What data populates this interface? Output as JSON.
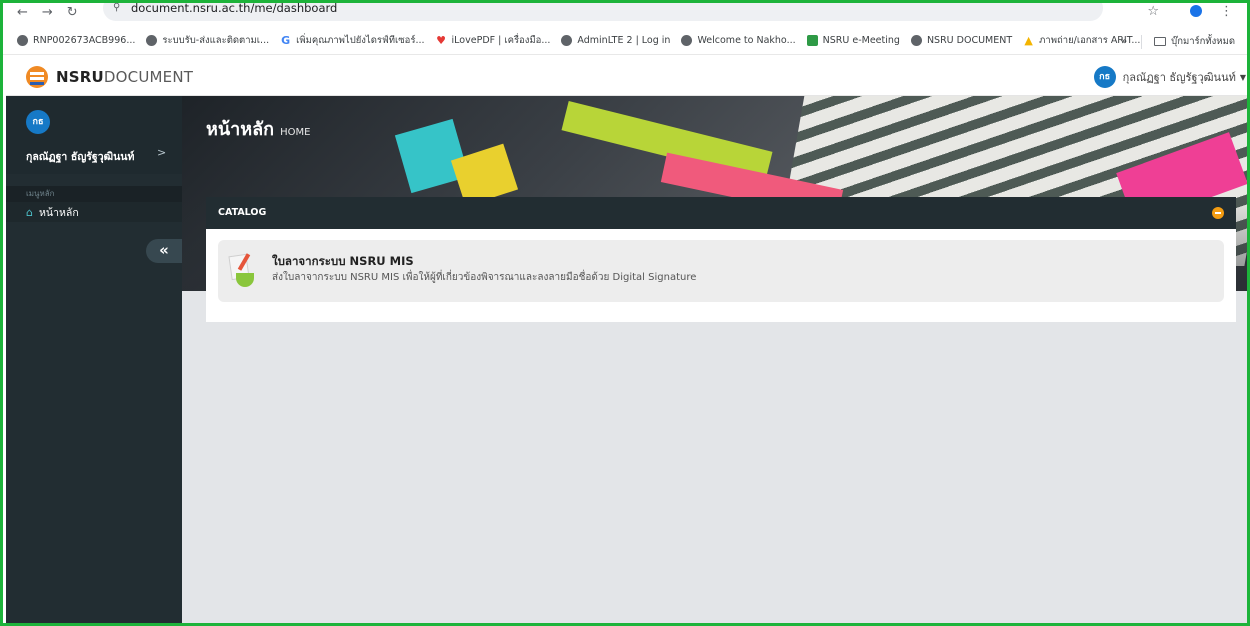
{
  "browser": {
    "url": "document.nsru.ac.th/me/dashboard",
    "bookmarks": [
      {
        "label": "RNP002673ACB996...",
        "icon": "globe-icon"
      },
      {
        "label": "ระบบรับ-ส่งและติดตามเ...",
        "icon": "globe-icon"
      },
      {
        "label": "เพิ่มคุณภาพไปยังไดรฟ์ทีเซอร์...",
        "icon": "google-icon"
      },
      {
        "label": "iLovePDF | เครื่องมือ...",
        "icon": "heart-icon"
      },
      {
        "label": "AdminLTE 2 | Log in",
        "icon": "globe-icon"
      },
      {
        "label": "Welcome to Nakho...",
        "icon": "globe-icon"
      },
      {
        "label": "NSRU e-Meeting",
        "icon": "nsru-icon"
      },
      {
        "label": "NSRU DOCUMENT",
        "icon": "globe-icon"
      },
      {
        "label": "ภาพถ่าย/เอกสาร ARIT...",
        "icon": "drive-icon"
      }
    ],
    "more_label": "»",
    "all_bookmarks_label": "บุ๊กมาร์กทั้งหมด"
  },
  "header": {
    "logo_bold": "NSRU",
    "logo_light": "DOCUMENT",
    "user_initials": "กธ",
    "user_name": "กุลณัฏฐา ธัญรัฐวุฒินนท์"
  },
  "sidebar": {
    "user_initials": "กธ",
    "user_name": "กุลณัฏฐา ธัญรัฐวุฒินนท์",
    "menu_header": "เมนูหลัก",
    "items": [
      {
        "label": "หน้าหลัก",
        "icon": "home-icon"
      }
    ],
    "collapse_label": "«"
  },
  "main": {
    "title": "หน้าหลัก",
    "subtitle": "HOME",
    "card": {
      "title": "CATALOG",
      "items": [
        {
          "title": "ใบลาจากระบบ NSRU MIS",
          "description": "ส่งใบลาจากระบบ NSRU MIS เพื่อให้ผู้ที่เกี่ยวข้องพิจารณาและลงลายมือชื่อด้วย Digital Signature"
        }
      ]
    }
  },
  "colors": {
    "frame": "#1db33a",
    "sidebar_bg": "#222d32",
    "accent_blue": "#1679c6",
    "tool_orange": "#f39c12"
  }
}
